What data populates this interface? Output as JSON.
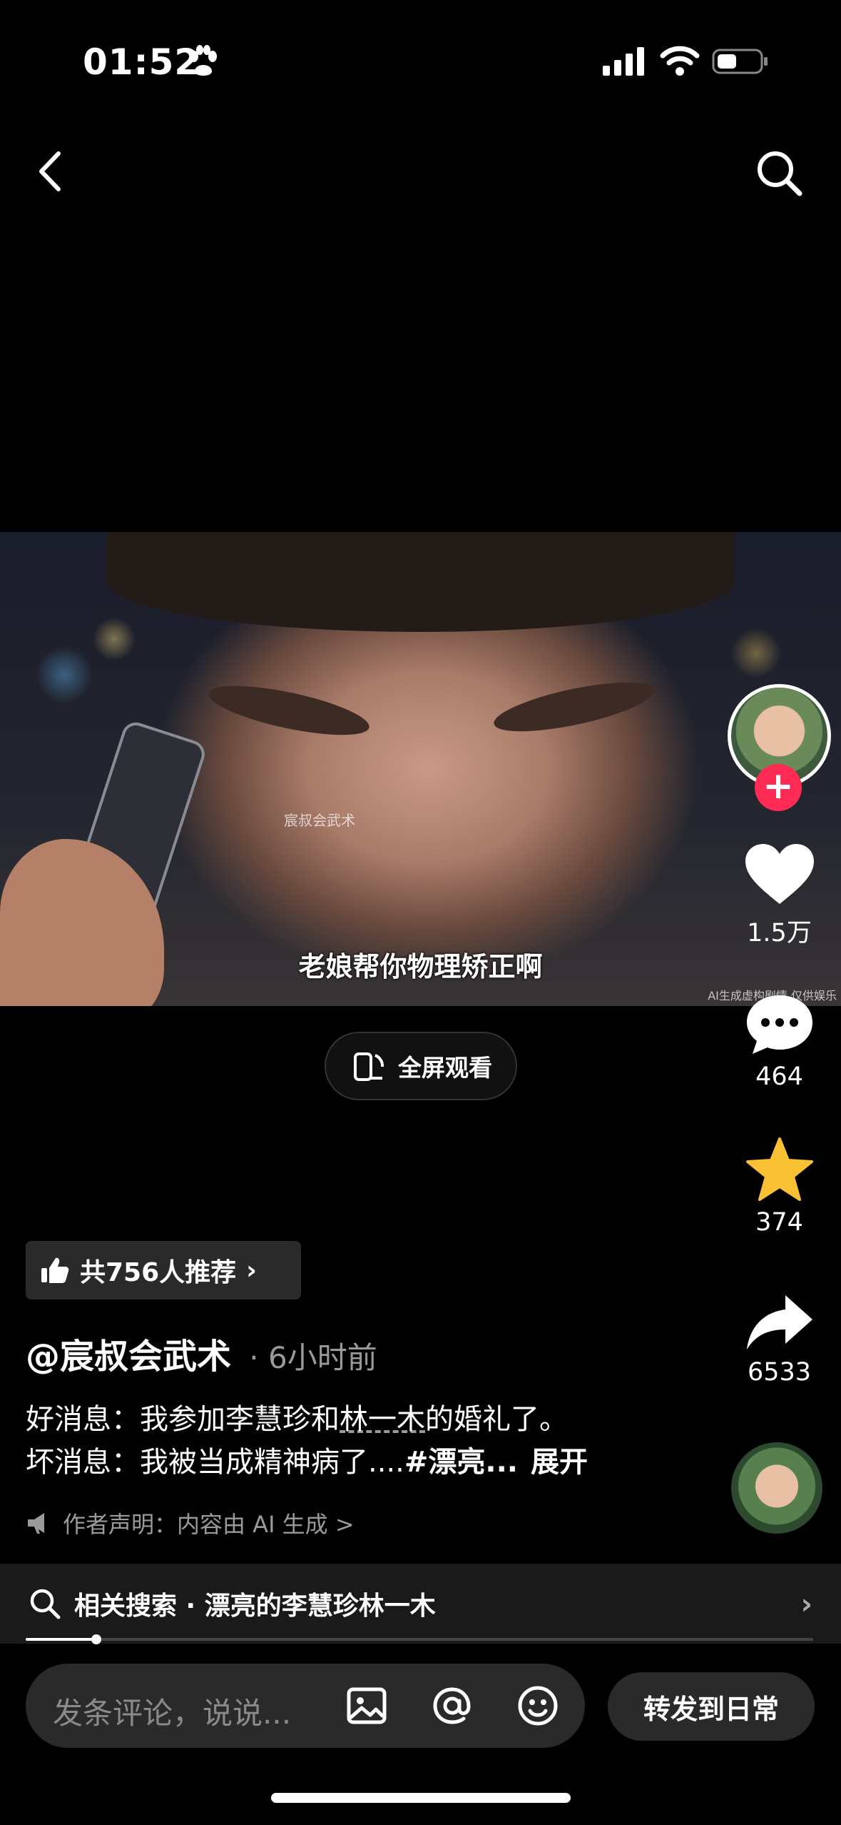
{
  "status_bar": {
    "time": "01:52"
  },
  "video": {
    "watermark": "宸叔会武术",
    "subtitle": "老娘帮你物理矫正啊",
    "ai_tag": "AI生成虚构剧情 仅供娱乐"
  },
  "fullscreen_label": "全屏观看",
  "actions": {
    "like_count": "1.5万",
    "comment_count": "464",
    "favorite_count": "374",
    "share_count": "6533"
  },
  "follow_symbol": "+",
  "recommend_label": "共756人推荐",
  "author": {
    "name": "@宸叔会武术",
    "time": "· 6小时前"
  },
  "description": {
    "line1_prefix": "好消息：我参加李慧珍和",
    "line1_link": "林一木",
    "line1_suffix": "的婚礼了。",
    "line2_text": "坏消息：我被当成精神病了....",
    "line2_tag": "#漂亮...",
    "expand": "展开"
  },
  "disclaimer": "作者声明：内容由 AI 生成 >",
  "related_search": {
    "label": "相关搜索 · 漂亮的李慧珍林一木"
  },
  "progress": {
    "fraction": 0.09
  },
  "comment_bar": {
    "placeholder": "发条评论，说说..."
  },
  "repost_label": "转发到日常",
  "colors": {
    "accent": "#fe2c55",
    "favorite": "#f8c133"
  },
  "icons": [
    "back-icon",
    "search-icon",
    "paw-icon",
    "signal-icon",
    "wifi-icon",
    "battery-icon",
    "heart-icon",
    "comment-icon",
    "star-icon",
    "share-icon",
    "thumb-up-icon",
    "megaphone-icon",
    "image-icon",
    "at-icon",
    "emoji-icon",
    "rotate-phone-icon"
  ]
}
